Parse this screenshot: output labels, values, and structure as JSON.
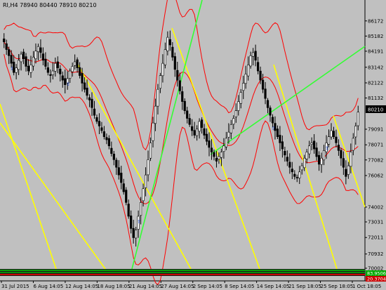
{
  "window": {
    "symbol_line": "RI,H4  78940 80440 78910 80210"
  },
  "colors": {
    "background": "#c0c0c0",
    "candle_up": "#ffffff",
    "candle_down": "#000000",
    "candle_wick": "#000000",
    "ma_band": "#ff0000",
    "trend_yellow": "#ffff00",
    "trend_green": "#33ff33",
    "price_tag": "#000000",
    "indicator_green": "#00cc00",
    "indicator_red": "#ff0000"
  },
  "chart_data": {
    "type": "candlestick",
    "current_price_label": "80210",
    "indicator_labels": [
      "83.9506",
      "20.3704"
    ],
    "y_ticks": [
      "86172",
      "85182",
      "84191",
      "83142",
      "82122",
      "81132",
      "79091",
      "78071",
      "77082",
      "76062",
      "74002",
      "73031",
      "72011",
      "70932",
      "70002"
    ],
    "x_ticks": [
      "31 Jul 2015",
      "6 Aug 14:05",
      "12 Aug 14:05",
      "18 Aug 18:05",
      "21 Aug 14:05",
      "27 Aug 14:05",
      "2 Sep 14:05",
      "8 Sep 14:05",
      "14 Sep 14:05",
      "21 Sep 18:05",
      "25 Sep 18:05",
      "1 Oct 18:05"
    ],
    "ylim": [
      70002,
      87172
    ],
    "closes": [
      84800,
      84300,
      83900,
      83400,
      82800,
      83100,
      83600,
      84000,
      83700,
      83200,
      82900,
      83300,
      83800,
      84200,
      84500,
      84100,
      83600,
      83200,
      82800,
      82600,
      82900,
      83400,
      83100,
      82700,
      82300,
      82000,
      82400,
      82900,
      83200,
      83500,
      83100,
      82600,
      82100,
      81700,
      81300,
      81000,
      80500,
      80000,
      79600,
      79300,
      79000,
      78600,
      78400,
      78000,
      77500,
      77100,
      76600,
      76100,
      75600,
      75000,
      74300,
      73400,
      72600,
      72000,
      72500,
      73400,
      74300,
      75200,
      76100,
      77100,
      78200,
      79500,
      80600,
      81700,
      82600,
      83400,
      84300,
      85100,
      84600,
      83800,
      83000,
      82300,
      81600,
      80900,
      80300,
      79800,
      79400,
      79000,
      78700,
      79100,
      79600,
      79200,
      78700,
      78300,
      77900,
      77600,
      77300,
      77000,
      77300,
      77600,
      78000,
      78500,
      78900,
      79400,
      79800,
      80300,
      80900,
      81500,
      82100,
      82700,
      83300,
      83900,
      84100,
      83600,
      82900,
      82300,
      81700,
      81100,
      80500,
      80000,
      79500,
      79000,
      78600,
      78200,
      77800,
      77400,
      77000,
      76600,
      76300,
      76000,
      75900,
      76300,
      76700,
      77200,
      77600,
      78000,
      78200,
      77800,
      77300,
      76800,
      77200,
      77700,
      78200,
      78600,
      79000,
      78600,
      78200,
      77700,
      77200,
      76600,
      76000,
      76700,
      77600,
      78500,
      79300,
      80210
    ]
  }
}
